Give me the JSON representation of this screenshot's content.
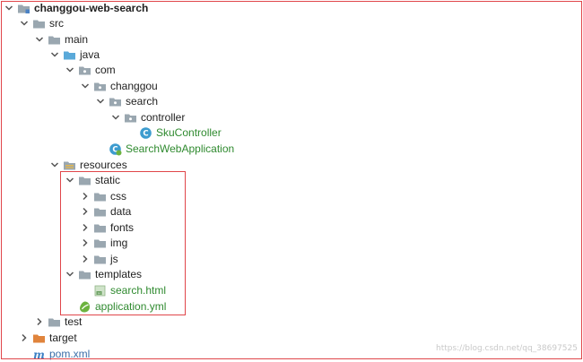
{
  "project_tree": {
    "rows": [
      {
        "id": "changgou-web-search",
        "label": "changgou-web-search",
        "expanded": true,
        "icon": "module-folder-icon",
        "style": "bold"
      },
      {
        "id": "src",
        "label": "src",
        "expanded": true,
        "icon": "folder-icon"
      },
      {
        "id": "main",
        "label": "main",
        "expanded": true,
        "icon": "folder-icon"
      },
      {
        "id": "java",
        "label": "java",
        "expanded": true,
        "icon": "source-root-folder-icon"
      },
      {
        "id": "com",
        "label": "com",
        "expanded": true,
        "icon": "package-icon"
      },
      {
        "id": "changgou",
        "label": "changgou",
        "expanded": true,
        "icon": "package-icon"
      },
      {
        "id": "search",
        "label": "search",
        "expanded": true,
        "icon": "package-icon"
      },
      {
        "id": "controller",
        "label": "controller",
        "expanded": true,
        "icon": "package-icon"
      },
      {
        "id": "SkuController",
        "label": "SkuController",
        "icon": "java-class-icon",
        "style": "green"
      },
      {
        "id": "SearchWebApplication",
        "label": "SearchWebApplication",
        "icon": "spring-boot-class-icon",
        "style": "green"
      },
      {
        "id": "resources",
        "label": "resources",
        "expanded": true,
        "icon": "resources-folder-icon"
      },
      {
        "id": "static",
        "label": "static",
        "expanded": true,
        "icon": "folder-icon"
      },
      {
        "id": "css",
        "label": "css",
        "expanded": false,
        "icon": "folder-icon"
      },
      {
        "id": "data",
        "label": "data",
        "expanded": false,
        "icon": "folder-icon"
      },
      {
        "id": "fonts",
        "label": "fonts",
        "expanded": false,
        "icon": "folder-icon"
      },
      {
        "id": "img",
        "label": "img",
        "expanded": false,
        "icon": "folder-icon"
      },
      {
        "id": "js",
        "label": "js",
        "expanded": false,
        "icon": "folder-icon"
      },
      {
        "id": "templates",
        "label": "templates",
        "expanded": true,
        "icon": "folder-icon"
      },
      {
        "id": "search.html",
        "label": "search.html",
        "icon": "html-file-icon",
        "style": "green"
      },
      {
        "id": "application.yml",
        "label": "application.yml",
        "icon": "yaml-spring-file-icon",
        "style": "green"
      },
      {
        "id": "test",
        "label": "test",
        "expanded": false,
        "icon": "folder-icon"
      },
      {
        "id": "target",
        "label": "target",
        "expanded": false,
        "icon": "excluded-folder-icon"
      },
      {
        "id": "pom.xml",
        "label": "pom.xml",
        "icon": "maven-pom-icon",
        "style": "blue"
      }
    ]
  },
  "colors": {
    "highlight_border": "#e0464a",
    "folder_gray": "#9aa7b0",
    "source_root_blue": "#5aa9d9",
    "excluded_orange": "#e0843c",
    "class_badge": "#3d9ccf",
    "green_text": "#2f8a2f"
  },
  "watermark": "https://blog.csdn.net/qq_38697525"
}
